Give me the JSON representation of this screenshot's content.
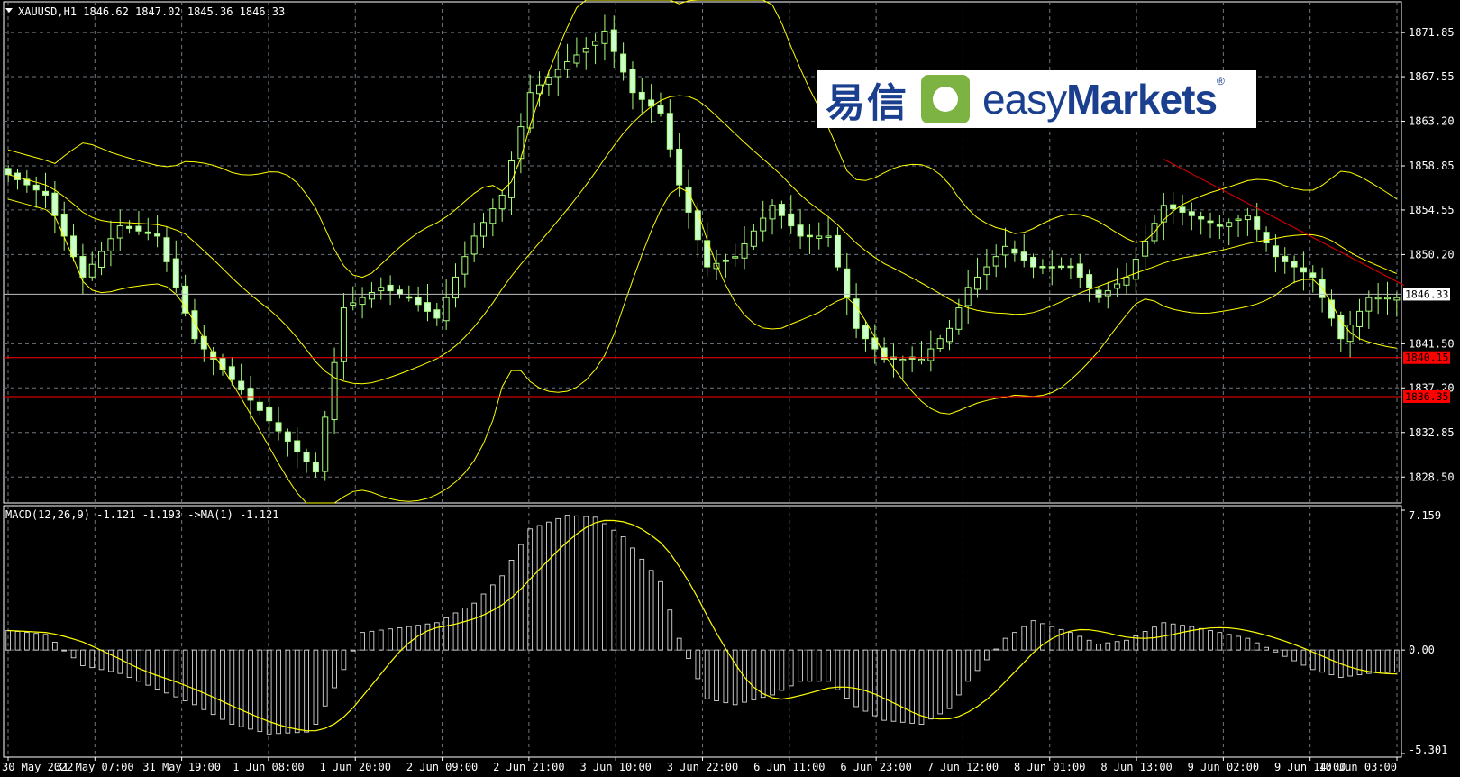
{
  "header": {
    "text": "XAUUSD,H1  1846.62 1847.02 1845.36 1846.33"
  },
  "macd_header": {
    "text": "MACD(12,26,9) -1.121 -1.193  ->MA(1) -1.121"
  },
  "logo": {
    "cn": "易信",
    "en_light": "easy",
    "en_bold": "Markets",
    "reg": "®"
  },
  "colors": {
    "background": "#000000",
    "grid": "#6e7780",
    "axis_text": "#ffffff",
    "candle": "#ccffcc",
    "wick": "#a8ff7a",
    "band": "#ffff00",
    "level": "#ff0000",
    "trend": "#cc0000",
    "macd_hist": "#d8d8d8",
    "macd_signal": "#ffff00"
  },
  "chart_data": [
    {
      "type": "candlestick",
      "title": "XAUUSD,H1",
      "ylim": [
        1826.5,
        1874.5
      ],
      "y_ticks": [
        "1871.85",
        "1867.55",
        "1863.20",
        "1858.85",
        "1854.55",
        "1850.20",
        "1841.50",
        "1837.20",
        "1832.85",
        "1828.50"
      ],
      "x_ticks": [
        "30 May 2022",
        "31 May 07:00",
        "31 May 19:00",
        "1 Jun 08:00",
        "1 Jun 20:00",
        "2 Jun 09:00",
        "2 Jun 21:00",
        "3 Jun 10:00",
        "3 Jun 22:00",
        "6 Jun 11:00",
        "6 Jun 23:00",
        "7 Jun 12:00",
        "8 Jun 01:00",
        "8 Jun 13:00",
        "9 Jun 02:00",
        "9 Jun 14:00",
        "10 Jun 03:00"
      ],
      "close_path": [
        [
          0,
          1858
        ],
        [
          4,
          1856
        ],
        [
          8,
          1848
        ],
        [
          12,
          1853
        ],
        [
          16,
          1852
        ],
        [
          20,
          1842
        ],
        [
          24,
          1838
        ],
        [
          28,
          1834
        ],
        [
          32,
          1830
        ],
        [
          33,
          1829
        ],
        [
          36,
          1845
        ],
        [
          40,
          1847
        ],
        [
          43,
          1846
        ],
        [
          46,
          1844
        ],
        [
          50,
          1852
        ],
        [
          53,
          1856
        ],
        [
          56,
          1866
        ],
        [
          60,
          1869
        ],
        [
          63,
          1871
        ],
        [
          64,
          1872
        ],
        [
          67,
          1866
        ],
        [
          70,
          1864
        ],
        [
          72,
          1857
        ],
        [
          75,
          1849
        ],
        [
          78,
          1850
        ],
        [
          82,
          1855
        ],
        [
          85,
          1852
        ],
        [
          88,
          1852
        ],
        [
          91,
          1843
        ],
        [
          94,
          1840
        ],
        [
          98,
          1840
        ],
        [
          101,
          1843
        ],
        [
          103,
          1847
        ],
        [
          107,
          1851
        ],
        [
          110,
          1849
        ],
        [
          114,
          1849
        ],
        [
          117,
          1846
        ],
        [
          120,
          1848
        ],
        [
          124,
          1855
        ],
        [
          127,
          1854
        ],
        [
          130,
          1853
        ],
        [
          133,
          1854
        ],
        [
          136,
          1850
        ],
        [
          140,
          1848
        ],
        [
          143,
          1842
        ],
        [
          146,
          1846
        ],
        [
          149,
          1846
        ]
      ],
      "current_price": {
        "value": 1846.33,
        "label": "1846.33"
      },
      "level_lines": [
        {
          "value": 1840.15,
          "label": "1840.15"
        },
        {
          "value": 1836.35,
          "label": "1836.35"
        }
      ],
      "trend_line": {
        "from": [
          124,
          1859.5
        ],
        "to": [
          149,
          1847.2
        ]
      }
    },
    {
      "type": "histogram",
      "title": "MACD(12,26,9)",
      "ylim": [
        -5.301,
        7.159
      ],
      "y_ticks": [
        "7.159",
        "0.00",
        "-5.301"
      ],
      "hist_path": [
        [
          0,
          1.0
        ],
        [
          4,
          0.8
        ],
        [
          8,
          -0.8
        ],
        [
          12,
          -1.2
        ],
        [
          16,
          -2.0
        ],
        [
          20,
          -2.8
        ],
        [
          24,
          -3.8
        ],
        [
          28,
          -4.3
        ],
        [
          32,
          -4.2
        ],
        [
          33,
          -3.8
        ],
        [
          36,
          -1.0
        ],
        [
          38,
          0.9
        ],
        [
          43,
          1.2
        ],
        [
          46,
          1.4
        ],
        [
          50,
          2.4
        ],
        [
          53,
          3.8
        ],
        [
          56,
          6.2
        ],
        [
          60,
          6.9
        ],
        [
          63,
          6.8
        ],
        [
          66,
          5.8
        ],
        [
          70,
          3.5
        ],
        [
          72,
          0.6
        ],
        [
          75,
          -2.5
        ],
        [
          78,
          -2.8
        ],
        [
          82,
          -2.3
        ],
        [
          85,
          -1.6
        ],
        [
          88,
          -1.6
        ],
        [
          91,
          -2.9
        ],
        [
          94,
          -3.6
        ],
        [
          98,
          -3.8
        ],
        [
          101,
          -3.0
        ],
        [
          103,
          -1.6
        ],
        [
          107,
          0.6
        ],
        [
          110,
          1.5
        ],
        [
          114,
          0.9
        ],
        [
          117,
          0.3
        ],
        [
          120,
          0.5
        ],
        [
          124,
          1.4
        ],
        [
          127,
          1.2
        ],
        [
          130,
          0.9
        ],
        [
          133,
          0.6
        ],
        [
          136,
          -0.1
        ],
        [
          140,
          -1.0
        ],
        [
          143,
          -1.4
        ],
        [
          146,
          -1.2
        ],
        [
          149,
          -1.12
        ]
      ],
      "signal_lag": 3,
      "values": {
        "macd": -1.121,
        "signal": -1.193
      }
    }
  ]
}
